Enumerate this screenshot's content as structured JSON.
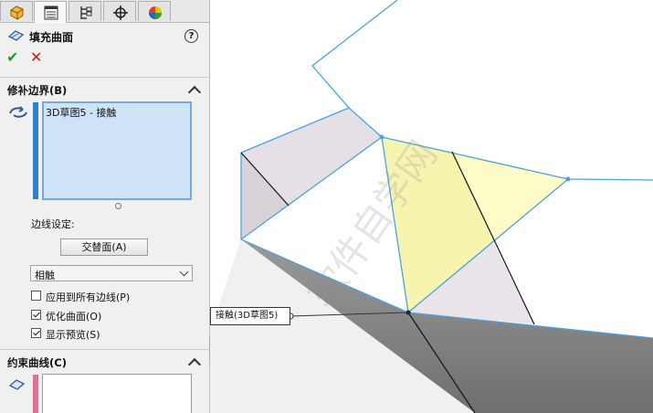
{
  "feature": {
    "title": "填充曲面",
    "help": "?",
    "ok": "✔",
    "cancel": "✕",
    "tabs": [
      "feature-manager-icon",
      "property-manager-icon",
      "configuration-manager-icon",
      "dimxpert-icon",
      "display-manager-icon"
    ]
  },
  "patch_boundary": {
    "header": "修补边界(B)",
    "items": [
      "3D草图5 - 接触"
    ],
    "edge_settings_label": "边线设定:",
    "alternate_face_button": "交替面(A)",
    "condition_value": "相触",
    "checkboxes": [
      {
        "label": "应用到所有边线(P)",
        "checked": false
      },
      {
        "label": "优化曲面(O)",
        "checked": true
      },
      {
        "label": "显示预览(S)",
        "checked": true
      }
    ]
  },
  "constraint_curves": {
    "header": "约束曲线(C)",
    "items": []
  },
  "viewport": {
    "callout": "接触(3D草图5)"
  },
  "colors": {
    "accent": "#1e73c8",
    "selection": "#cfe3f7",
    "preview_fill": "#f7f4b0",
    "face_grey": "#e4e0e6",
    "solid_dark": "#8a8a8a",
    "edge_blue": "#4aa3df"
  }
}
